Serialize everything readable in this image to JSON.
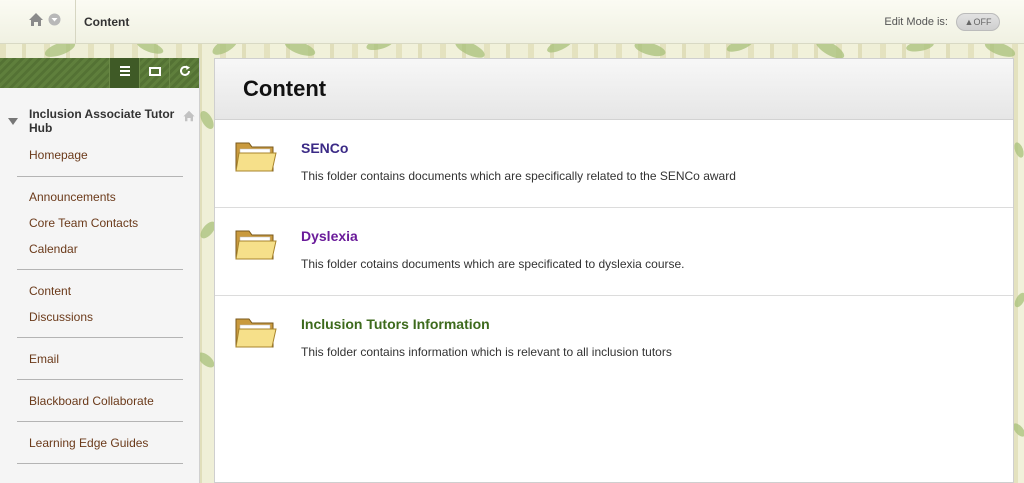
{
  "breadcrumb": {
    "current": "Content"
  },
  "edit_mode": {
    "label": "Edit Mode is:",
    "state": "OFF"
  },
  "course_menu": {
    "title": "Inclusion Associate Tutor Hub",
    "items": [
      "Homepage",
      "Announcements",
      "Core Team Contacts",
      "Calendar",
      "Content",
      "Discussions",
      "Email",
      "Blackboard Collaborate",
      "Learning Edge Guides"
    ]
  },
  "content": {
    "title": "Content",
    "items": [
      {
        "title": "SENCo",
        "description": "This folder contains documents which are specifically related to the SENCo award",
        "color": "#3b2a86"
      },
      {
        "title": "Dyslexia",
        "description": "This folder cotains documents which are specificated to dyslexia course.",
        "color": "#6a1b9a"
      },
      {
        "title": "Inclusion Tutors Information",
        "description": "This folder contains information which is relevant to all inclusion tutors",
        "color": "#3d6a1c"
      }
    ]
  },
  "icons": {
    "home": "home-icon",
    "dropdown": "chevron-down-icon",
    "menu_list": "list-icon",
    "menu_folder_view": "folder-view-icon",
    "menu_refresh": "refresh-icon",
    "folder": "folder-icon"
  }
}
